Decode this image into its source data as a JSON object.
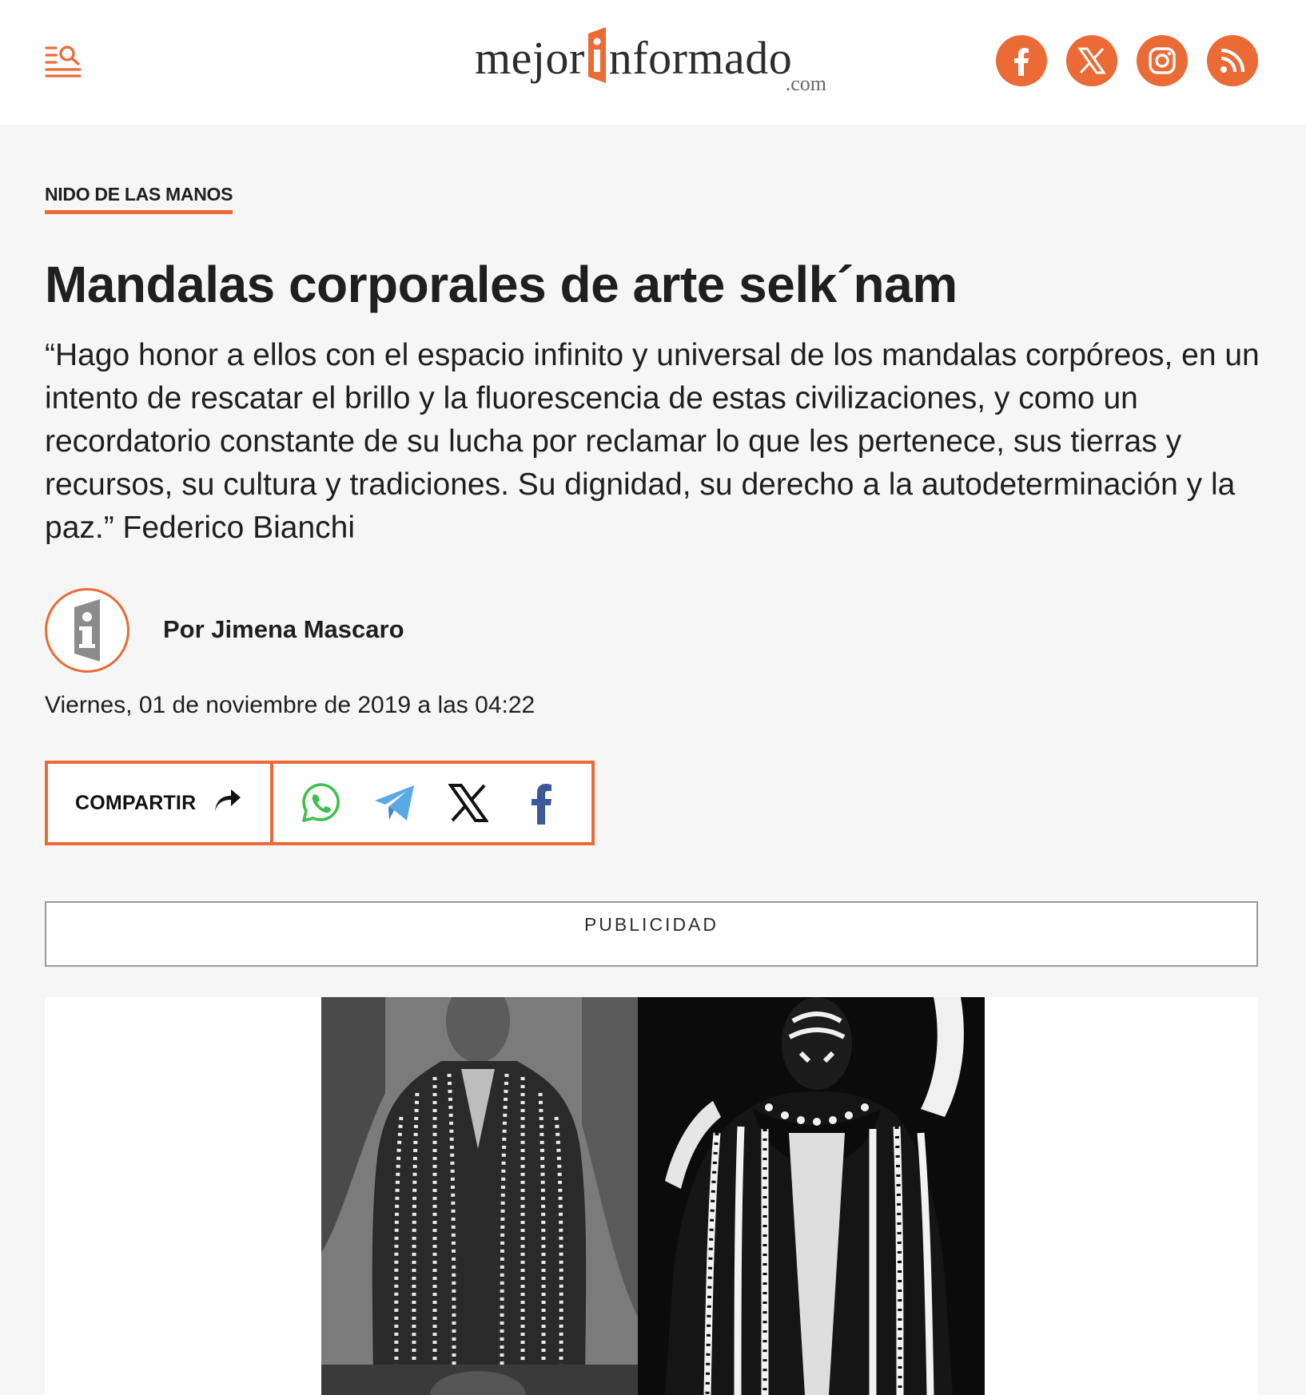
{
  "header": {
    "logo_left": "mejor",
    "logo_right": "nformado",
    "logo_domain": ".com",
    "social": [
      "facebook-icon",
      "x-icon",
      "instagram-icon",
      "rss-icon"
    ]
  },
  "article": {
    "section": "NIDO DE LAS MANOS",
    "title": "Mandalas corporales de arte selk´nam",
    "lead": "“Hago honor a ellos con el espacio infinito y universal de los mandalas corpóreos, en un intento de rescatar el brillo y la fluorescencia de estas civilizaciones, y como un recordatorio constante de su lucha por reclamar lo que les pertenece, sus tierras y recursos, su cultura y tradiciones. Su dignidad, su derecho a la autodeterminación y la paz.” Federico Bianchi",
    "author": "Por Jimena Mascaro",
    "date": "Viernes, 01 de noviembre de 2019 a las 04:22"
  },
  "share": {
    "label": "COMPARTIR",
    "icons": [
      "whatsapp-icon",
      "telegram-icon",
      "x-icon",
      "facebook-icon"
    ]
  },
  "ad": {
    "label": "PUBLICIDAD"
  },
  "colors": {
    "accent": "#ec6a36",
    "text": "#1f1f1f",
    "background": "#f6f6f6"
  }
}
